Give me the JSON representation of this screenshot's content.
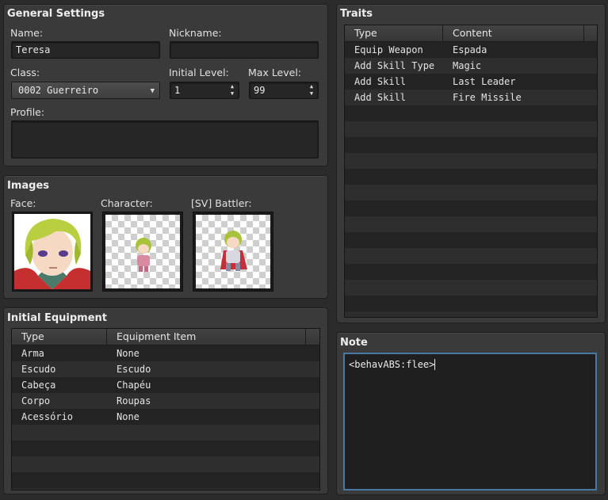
{
  "general": {
    "title": "General Settings",
    "name_label": "Name:",
    "name_value": "Teresa",
    "nickname_label": "Nickname:",
    "nickname_value": "",
    "class_label": "Class:",
    "class_value": "0002 Guerreiro",
    "initial_level_label": "Initial Level:",
    "initial_level_value": "1",
    "max_level_label": "Max Level:",
    "max_level_value": "99",
    "profile_label": "Profile:",
    "profile_value": ""
  },
  "images": {
    "title": "Images",
    "face_label": "Face:",
    "character_label": "Character:",
    "battler_label": "[SV] Battler:"
  },
  "equipment": {
    "title": "Initial Equipment",
    "columns": [
      "Type",
      "Equipment Item"
    ],
    "rows": [
      [
        "Arma",
        "None"
      ],
      [
        "Escudo",
        "Escudo"
      ],
      [
        "Cabeça",
        "Chapéu"
      ],
      [
        "Corpo",
        "Roupas"
      ],
      [
        "Acessório",
        "None"
      ]
    ]
  },
  "traits": {
    "title": "Traits",
    "columns": [
      "Type",
      "Content"
    ],
    "rows": [
      [
        "Equip Weapon",
        "Espada"
      ],
      [
        "Add Skill Type",
        "Magic"
      ],
      [
        "Add Skill",
        "Last Leader"
      ],
      [
        "Add Skill",
        "Fire Missile"
      ]
    ]
  },
  "note": {
    "title": "Note",
    "value": "<behavABS:flee>"
  },
  "colors": {
    "note_focus_border": "#4a78a6",
    "panel_bg": "#3a3a3a",
    "window_bg": "#2b2b2b"
  }
}
